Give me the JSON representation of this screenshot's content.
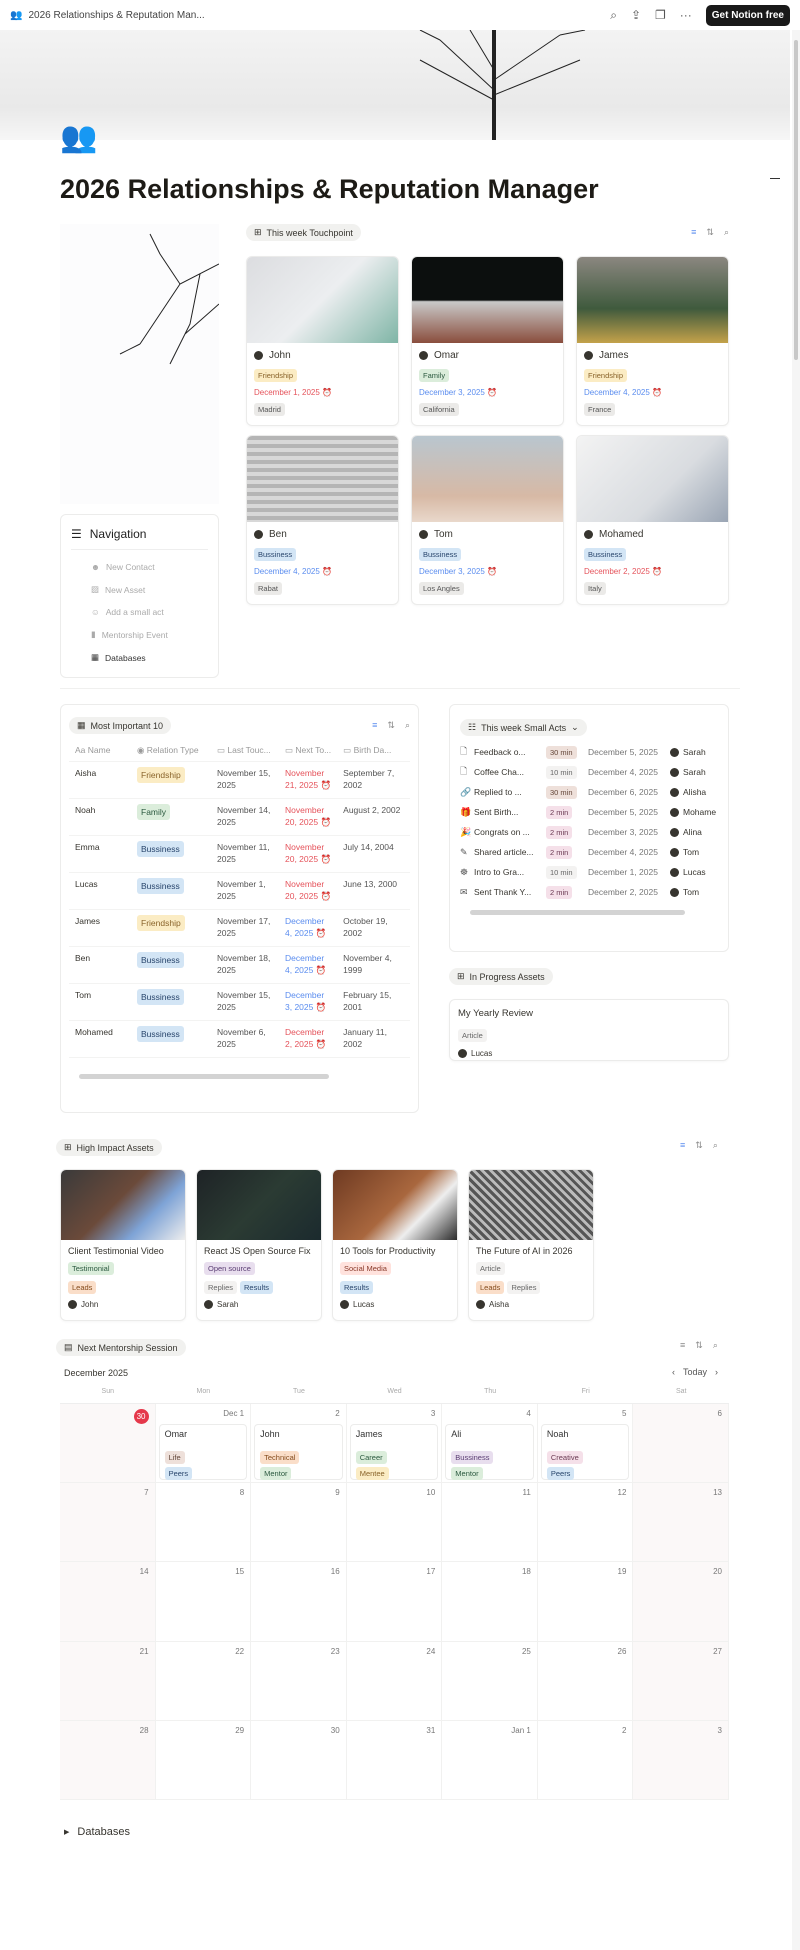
{
  "topbar": {
    "breadcrumb": "2026 Relationships & Reputation Man...",
    "cta": "Get Notion free",
    "icons": [
      "search-icon",
      "share-icon",
      "duplicate-icon",
      "more-icon"
    ]
  },
  "page": {
    "title": "2026 Relationships & Reputation Manager",
    "icon": "people-icon"
  },
  "touchpoint": {
    "label": "This week Touchpoint",
    "cards": [
      {
        "name": "John",
        "tag": "Friendship",
        "tagc": "t-yellow",
        "date": "December 1, 2025",
        "datec": "red",
        "loc": "Madrid",
        "img": "linear-gradient(135deg,#dcdde0,#eceef0 50%,#7fb5a6)"
      },
      {
        "name": "Omar",
        "tag": "Family",
        "tagc": "t-green",
        "date": "December 3, 2025",
        "datec": "blue",
        "loc": "California",
        "img": "linear-gradient(180deg,#0c0f0e 50%,#c9c9c9 52%,#8a4d3d)"
      },
      {
        "name": "James",
        "tag": "Friendship",
        "tagc": "t-yellow",
        "date": "December 4, 2025",
        "datec": "blue",
        "loc": "France",
        "img": "linear-gradient(180deg,#8b8780,#3f5a3d 60%,#c4a24a)"
      },
      {
        "name": "Ben",
        "tag": "Bussiness",
        "tagc": "t-blue",
        "date": "December 4, 2025",
        "datec": "blue",
        "loc": "Rabat",
        "img": "repeating-linear-gradient(180deg,#b5b5b5 0 4px,#d8d8d8 4px 8px)"
      },
      {
        "name": "Tom",
        "tag": "Bussiness",
        "tagc": "t-blue",
        "date": "December 3, 2025",
        "datec": "blue",
        "loc": "Los Angles",
        "img": "linear-gradient(180deg,#b9c6cf,#d7b9a5 70%,#e9d8cb)"
      },
      {
        "name": "Mohamed",
        "tag": "Bussiness",
        "tagc": "t-blue",
        "date": "December 2, 2025",
        "datec": "red",
        "loc": "Italy",
        "img": "linear-gradient(135deg,#f3f3f3,#d9dce0 60%,#9aa5b4)"
      }
    ]
  },
  "navigation": {
    "title": "Navigation",
    "items": [
      "New Contact",
      "New Asset",
      "Add a small act",
      "Mentorship Event",
      "Databases"
    ]
  },
  "important": {
    "label": "Most Important 10",
    "columns": [
      "Name",
      "Relation Type",
      "Last Touc...",
      "Next To...",
      "Birth Da..."
    ],
    "rows": [
      {
        "name": "Aisha",
        "type": "Friendship",
        "tc": "t-yellow",
        "last": "November 15, 2025",
        "next": "November 21, 2025",
        "nc": "red",
        "birth": "September 7, 2002"
      },
      {
        "name": "Noah",
        "type": "Family",
        "tc": "t-green",
        "last": "November 14, 2025",
        "next": "November 20, 2025",
        "nc": "red",
        "birth": "August 2, 2002"
      },
      {
        "name": "Emma",
        "type": "Bussiness",
        "tc": "t-blue",
        "last": "November 11, 2025",
        "next": "November 20, 2025",
        "nc": "red",
        "birth": "July 14, 2004"
      },
      {
        "name": "Lucas",
        "type": "Bussiness",
        "tc": "t-blue",
        "last": "November 1, 2025",
        "next": "November 20, 2025",
        "nc": "red",
        "birth": "June 13, 2000"
      },
      {
        "name": "James",
        "type": "Friendship",
        "tc": "t-yellow",
        "last": "November 17, 2025",
        "next": "December 4, 2025",
        "nc": "blue",
        "birth": "October 19, 2002"
      },
      {
        "name": "Ben",
        "type": "Bussiness",
        "tc": "t-blue",
        "last": "November 18, 2025",
        "next": "December 4, 2025",
        "nc": "blue",
        "birth": "November 4, 1999"
      },
      {
        "name": "Tom",
        "type": "Bussiness",
        "tc": "t-blue",
        "last": "November 15, 2025",
        "next": "December 3, 2025",
        "nc": "blue",
        "birth": "February 15, 2001"
      },
      {
        "name": "Mohamed",
        "type": "Bussiness",
        "tc": "t-blue",
        "last": "November 6, 2025",
        "next": "December 2, 2025",
        "nc": "red",
        "birth": "January 11, 2002"
      }
    ]
  },
  "small_acts": {
    "label": "This week Small Acts",
    "rows": [
      {
        "icon": "🗋",
        "title": "Feedback o...",
        "dur": "30 min",
        "dc": "t-brown",
        "date": "December 5, 2025",
        "who": "Sarah"
      },
      {
        "icon": "🗋",
        "title": "Coffee Cha...",
        "dur": "10 min",
        "dc": "t-light",
        "date": "December 4, 2025",
        "who": "Sarah"
      },
      {
        "icon": "🔗",
        "title": "Replied to ...",
        "dur": "30 min",
        "dc": "t-brown",
        "date": "December 6, 2025",
        "who": "Alisha"
      },
      {
        "icon": "🎁",
        "title": "Sent Birth...",
        "dur": "2 min",
        "dc": "t-pink",
        "date": "December 5, 2025",
        "who": "Mohame"
      },
      {
        "icon": "🎉",
        "title": "Congrats on ...",
        "dur": "2 min",
        "dc": "t-pink",
        "date": "December 3, 2025",
        "who": "Alina"
      },
      {
        "icon": "✎",
        "title": "Shared article...",
        "dur": "2 min",
        "dc": "t-pink",
        "date": "December 4, 2025",
        "who": "Tom"
      },
      {
        "icon": "☸",
        "title": "Intro to Gra...",
        "dur": "10 min",
        "dc": "t-light",
        "date": "December 1, 2025",
        "who": "Lucas"
      },
      {
        "icon": "✉",
        "title": "Sent Thank Y...",
        "dur": "2 min",
        "dc": "t-pink",
        "date": "December 2, 2025",
        "who": "Tom"
      }
    ]
  },
  "in_progress": {
    "label": "In Progress Assets",
    "card": {
      "title": "My Yearly Review",
      "tag": "Article",
      "who": "Lucas"
    }
  },
  "high_impact": {
    "label": "High Impact Assets",
    "cards": [
      {
        "title": "Client Testimonial Video",
        "tags": [
          [
            "Testimonial",
            "t-green"
          ]
        ],
        "tags2": [
          [
            "Leads",
            "t-orange"
          ]
        ],
        "who": "John",
        "img": "linear-gradient(135deg,#3a3a3a,#6b4a3a 45%,#7ea3d6 70%,#eee)"
      },
      {
        "title": "React JS Open Source Fix",
        "tags": [
          [
            "Open source",
            "t-purple"
          ]
        ],
        "tags2": [
          [
            "Replies",
            "t-light"
          ],
          [
            "Results",
            "t-blue"
          ]
        ],
        "who": "Sarah",
        "img": "linear-gradient(135deg,#1e2326,#2b3b33 50%,#1b2a2e)"
      },
      {
        "title": "10 Tools for Productivity",
        "tags": [
          [
            "Social Media",
            "t-red"
          ]
        ],
        "tags2": [
          [
            "Results",
            "t-blue"
          ]
        ],
        "who": "Lucas",
        "img": "linear-gradient(135deg,#6e3a22,#a9673e 50%,#eee 70%,#2a2a2a)"
      },
      {
        "title": "The Future of AI in 2026",
        "tags": [
          [
            "Article",
            "t-light"
          ]
        ],
        "tags2": [
          [
            "Leads",
            "t-orange"
          ],
          [
            "Replies",
            "t-light"
          ]
        ],
        "who": "Aisha",
        "img": "repeating-linear-gradient(45deg,#555 0 3px,#bbb 3px 6px)"
      }
    ]
  },
  "mentorship": {
    "label": "Next Mentorship Session",
    "month": "December 2025",
    "today": "Today",
    "weekdays": [
      "Sun",
      "Mon",
      "Tue",
      "Wed",
      "Thu",
      "Fri",
      "Sat"
    ],
    "days": [
      "30",
      "Dec 1",
      "2",
      "3",
      "4",
      "5",
      "6",
      "7",
      "8",
      "9",
      "10",
      "11",
      "12",
      "13",
      "14",
      "15",
      "16",
      "17",
      "18",
      "19",
      "20",
      "21",
      "22",
      "23",
      "24",
      "25",
      "26",
      "27",
      "28",
      "29",
      "30",
      "31",
      "Jan 1",
      "2",
      "3"
    ],
    "events": [
      {
        "day": 1,
        "name": "Omar",
        "tags": [
          [
            "Life",
            "t-brown"
          ],
          [
            "Peers",
            "t-blue"
          ]
        ]
      },
      {
        "day": 2,
        "name": "John",
        "tags": [
          [
            "Technical",
            "t-orange"
          ],
          [
            "Mentor",
            "t-green"
          ]
        ]
      },
      {
        "day": 3,
        "name": "James",
        "tags": [
          [
            "Career",
            "t-green"
          ],
          [
            "Mentee",
            "t-yellow"
          ]
        ]
      },
      {
        "day": 4,
        "name": "Ali",
        "tags": [
          [
            "Bussiness",
            "t-purple"
          ],
          [
            "Mentor",
            "t-green"
          ]
        ]
      },
      {
        "day": 5,
        "name": "Noah",
        "tags": [
          [
            "Creative",
            "t-pink"
          ],
          [
            "Peers",
            "t-blue"
          ]
        ]
      }
    ]
  },
  "footer_toggle": {
    "label": "Databases"
  },
  "colors": {
    "accent_red": "#e5384b",
    "date_blue": "#5b8def",
    "date_red": "#e5535b"
  }
}
